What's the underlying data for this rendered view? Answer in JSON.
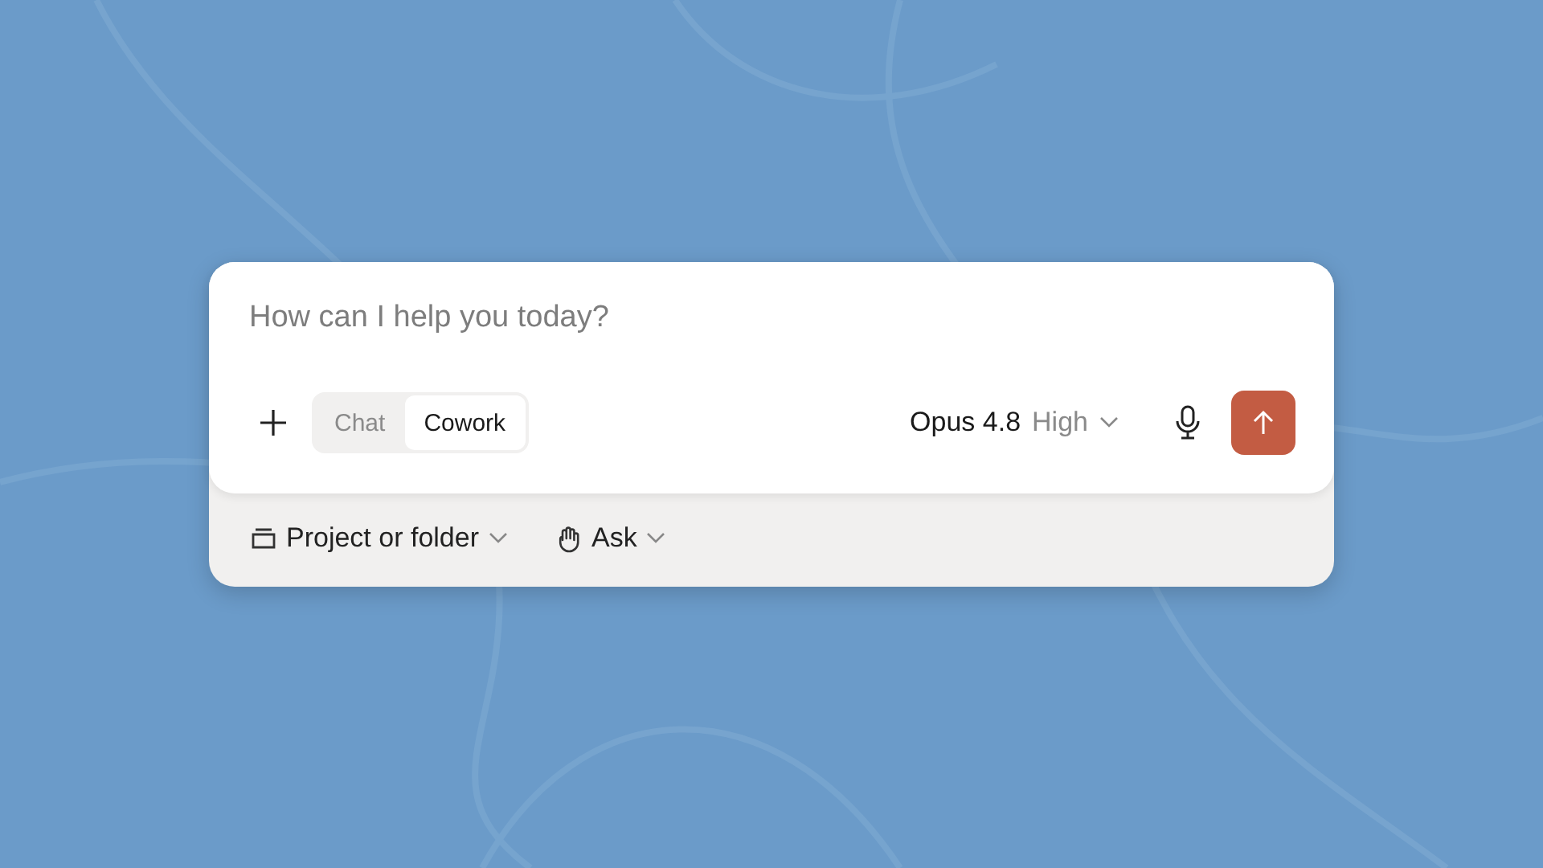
{
  "input": {
    "placeholder": "How can I help you today?"
  },
  "mode_tabs": [
    {
      "label": "Chat",
      "selected": false
    },
    {
      "label": "Cowork",
      "selected": true
    }
  ],
  "model": {
    "name": "Opus 4.8",
    "effort": "High"
  },
  "options": [
    {
      "kind": "folder",
      "label": "Project or folder"
    },
    {
      "kind": "hand",
      "label": "Ask"
    }
  ]
}
